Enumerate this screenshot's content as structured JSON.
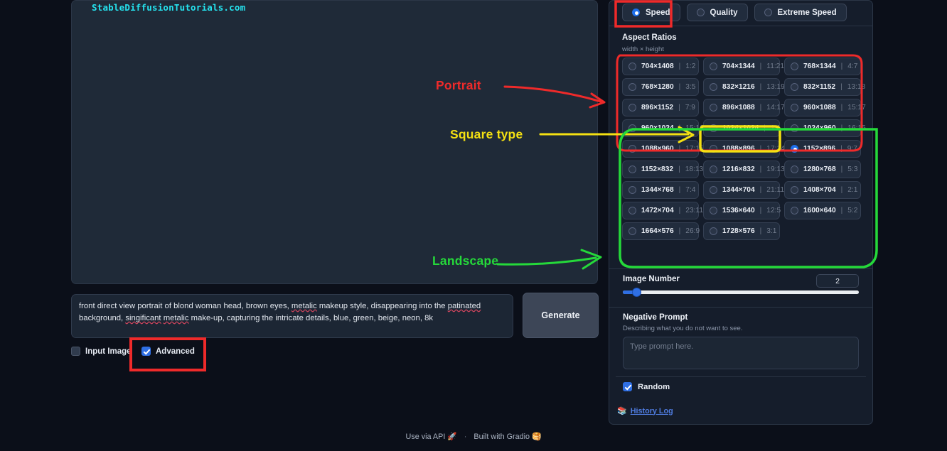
{
  "app": {
    "watermark": "StableDiffusionTutorials.com"
  },
  "gallery": {
    "scrollbar": "vertical-scrollbar",
    "resize": "resize-grip"
  },
  "performance": {
    "options": [
      {
        "label": "Speed",
        "selected": true
      },
      {
        "label": "Quality",
        "selected": false
      },
      {
        "label": "Extreme Speed",
        "selected": false
      }
    ]
  },
  "aspect_ratios": {
    "title": "Aspect Ratios",
    "subtitle": "width × height",
    "separator": "|",
    "items": [
      {
        "dim": "704×1408",
        "ratio": "1:2",
        "selected": false
      },
      {
        "dim": "704×1344",
        "ratio": "11:21",
        "selected": false
      },
      {
        "dim": "768×1344",
        "ratio": "4:7",
        "selected": false
      },
      {
        "dim": "768×1280",
        "ratio": "3:5",
        "selected": false
      },
      {
        "dim": "832×1216",
        "ratio": "13:19",
        "selected": false
      },
      {
        "dim": "832×1152",
        "ratio": "13:18",
        "selected": false
      },
      {
        "dim": "896×1152",
        "ratio": "7:9",
        "selected": false
      },
      {
        "dim": "896×1088",
        "ratio": "14:17",
        "selected": false
      },
      {
        "dim": "960×1088",
        "ratio": "15:17",
        "selected": false
      },
      {
        "dim": "960×1024",
        "ratio": "15:16",
        "selected": false
      },
      {
        "dim": "1024×1024",
        "ratio": "1:1",
        "selected": false
      },
      {
        "dim": "1024×960",
        "ratio": "16:15",
        "selected": false
      },
      {
        "dim": "1088×960",
        "ratio": "17:15",
        "selected": false
      },
      {
        "dim": "1088×896",
        "ratio": "17:14",
        "selected": false
      },
      {
        "dim": "1152×896",
        "ratio": "9:7",
        "selected": true
      },
      {
        "dim": "1152×832",
        "ratio": "18:13",
        "selected": false
      },
      {
        "dim": "1216×832",
        "ratio": "19:13",
        "selected": false
      },
      {
        "dim": "1280×768",
        "ratio": "5:3",
        "selected": false
      },
      {
        "dim": "1344×768",
        "ratio": "7:4",
        "selected": false
      },
      {
        "dim": "1344×704",
        "ratio": "21:11",
        "selected": false
      },
      {
        "dim": "1408×704",
        "ratio": "2:1",
        "selected": false
      },
      {
        "dim": "1472×704",
        "ratio": "23:11",
        "selected": false
      },
      {
        "dim": "1536×640",
        "ratio": "12:5",
        "selected": false
      },
      {
        "dim": "1600×640",
        "ratio": "5:2",
        "selected": false
      },
      {
        "dim": "1664×576",
        "ratio": "26:9",
        "selected": false
      },
      {
        "dim": "1728×576",
        "ratio": "3:1",
        "selected": false
      }
    ]
  },
  "image_number": {
    "label": "Image Number",
    "value": "2",
    "slider_percent": 6
  },
  "negative_prompt": {
    "label": "Negative Prompt",
    "description": "Describing what you do not want to see.",
    "placeholder": "Type prompt here.",
    "value": ""
  },
  "random": {
    "label": "Random",
    "checked": true
  },
  "history": {
    "label": "History Log",
    "icon": "book-icon"
  },
  "prompt": {
    "value": "front direct view portrait of blond woman head, brown eyes, metalic makeup style, disappearing into the patinated background, singificant metalic make-up, capturing the intricate details, blue, green, beige, neon, 8k"
  },
  "generate": {
    "label": "Generate"
  },
  "toggles": {
    "input_image": {
      "label": "Input Image",
      "checked": false
    },
    "advanced": {
      "label": "Advanced",
      "checked": true
    }
  },
  "footer": {
    "api_label": "Use via API",
    "api_icon": "rocket-icon",
    "separator": "·",
    "gradio_label": "Built with Gradio",
    "gradio_icon": "gradio-logo"
  },
  "annotations": {
    "portrait": {
      "label": "Portrait",
      "color": "#ef2a2a"
    },
    "square": {
      "label": "Square type",
      "color": "#f4e012"
    },
    "landscape": {
      "label": "Landscape",
      "color": "#25d93a"
    }
  }
}
